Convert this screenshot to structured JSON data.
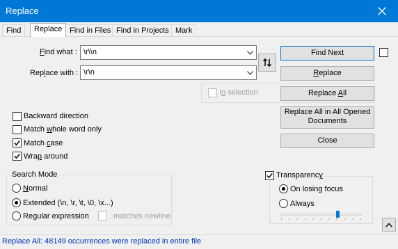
{
  "window": {
    "title": "Replace"
  },
  "tabs": [
    "Find",
    "Replace",
    "Find in Files",
    "Find in Projects",
    "Mark"
  ],
  "find": {
    "label": "Find what :",
    "value": "\\r\\\\n"
  },
  "replace": {
    "label": "Replace with :",
    "value": "\\r\\n"
  },
  "in_selection": {
    "label": "In selection",
    "checked": false
  },
  "buttons": {
    "find_next": "Find Next",
    "replace": "Replace",
    "replace_all": "Replace All",
    "replace_all_opened_line1": "Replace All in All Opened",
    "replace_all_opened_line2": "Documents",
    "close": "Close"
  },
  "options": {
    "backward": {
      "label": "Backward direction",
      "checked": false
    },
    "whole_word": {
      "label": "Match whole word only",
      "checked": false
    },
    "match_case": {
      "label": "Match case",
      "checked": true
    },
    "wrap_around": {
      "label": "Wrap around",
      "checked": true
    }
  },
  "search_mode": {
    "title": "Search Mode",
    "normal": "Normal",
    "extended": "Extended (\\n, \\r, \\t, \\0, \\x...)",
    "regex": "Regular expression",
    "matches_newline": ". matches newline",
    "selected": "extended"
  },
  "transparency": {
    "label": "Transparency",
    "checked": true,
    "on_losing_focus": "On losing focus",
    "always": "Always",
    "selected": "on_losing_focus",
    "level": 0.72
  },
  "status": "Replace All: 48149 occurrences were replaced in entire file",
  "colors": {
    "titlebar": "#0078d7",
    "status_text": "#0033bb"
  }
}
